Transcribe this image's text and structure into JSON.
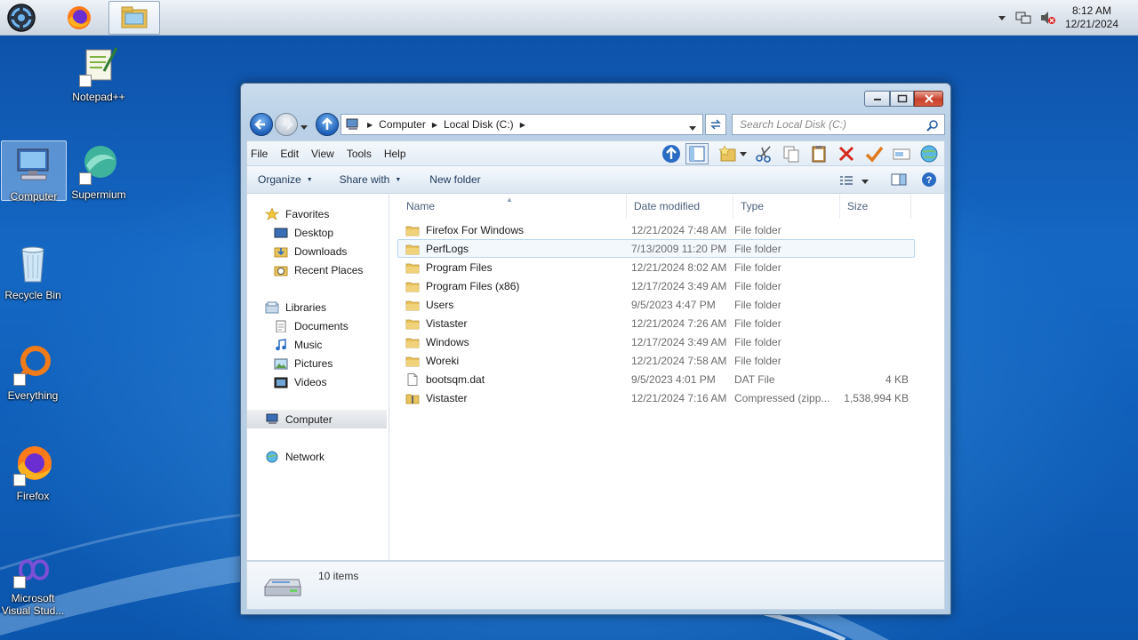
{
  "taskbar": {
    "clock_time": "8:12 AM",
    "clock_date": "12/21/2024",
    "apps": [
      "start-orb",
      "firefox",
      "file-explorer"
    ]
  },
  "desktop": {
    "icons": [
      {
        "label": "Notepad++"
      },
      {
        "label": "Computer"
      },
      {
        "label": "Supermium"
      },
      {
        "label": "Recycle Bin"
      },
      {
        "label": "Everything"
      },
      {
        "label": "Firefox"
      },
      {
        "label": "Microsoft Visual Stud..."
      }
    ]
  },
  "explorer": {
    "breadcrumb": [
      "Computer",
      "Local Disk (C:)"
    ],
    "search_placeholder": "Search Local Disk (C:)",
    "menu": [
      "File",
      "Edit",
      "View",
      "Tools",
      "Help"
    ],
    "commands": {
      "organize": "Organize",
      "share_with": "Share with",
      "new_folder": "New folder"
    },
    "nav": {
      "favorites": "Favorites",
      "favorites_items": [
        "Desktop",
        "Downloads",
        "Recent Places"
      ],
      "libraries": "Libraries",
      "libraries_items": [
        "Documents",
        "Music",
        "Pictures",
        "Videos"
      ],
      "computer": "Computer",
      "network": "Network"
    },
    "columns": {
      "name": "Name",
      "date": "Date modified",
      "type": "Type",
      "size": "Size"
    },
    "files": [
      {
        "name": "Firefox For Windows",
        "date": "12/21/2024 7:48 AM",
        "type": "File folder",
        "size": "",
        "kind": "folder"
      },
      {
        "name": "PerfLogs",
        "date": "7/13/2009 11:20 PM",
        "type": "File folder",
        "size": "",
        "kind": "folder"
      },
      {
        "name": "Program Files",
        "date": "12/21/2024 8:02 AM",
        "type": "File folder",
        "size": "",
        "kind": "folder"
      },
      {
        "name": "Program Files (x86)",
        "date": "12/17/2024 3:49 AM",
        "type": "File folder",
        "size": "",
        "kind": "folder"
      },
      {
        "name": "Users",
        "date": "9/5/2023 4:47 PM",
        "type": "File folder",
        "size": "",
        "kind": "folder"
      },
      {
        "name": "Vistaster",
        "date": "12/21/2024 7:26 AM",
        "type": "File folder",
        "size": "",
        "kind": "folder"
      },
      {
        "name": "Windows",
        "date": "12/17/2024 3:49 AM",
        "type": "File folder",
        "size": "",
        "kind": "folder"
      },
      {
        "name": "Woreki",
        "date": "12/21/2024 7:58 AM",
        "type": "File folder",
        "size": "",
        "kind": "folder"
      },
      {
        "name": "bootsqm.dat",
        "date": "9/5/2023 4:01 PM",
        "type": "DAT File",
        "size": "4 KB",
        "kind": "file"
      },
      {
        "name": "Vistaster",
        "date": "12/21/2024 7:16 AM",
        "type": "Compressed (zipp...",
        "size": "1,538,994 KB",
        "kind": "zip"
      }
    ],
    "highlighted_row": 1,
    "status": {
      "items_count": "10 items"
    }
  },
  "colors": {
    "folder": "#e8c25a",
    "accent": "#1d5fb8",
    "close": "#c8412b"
  }
}
